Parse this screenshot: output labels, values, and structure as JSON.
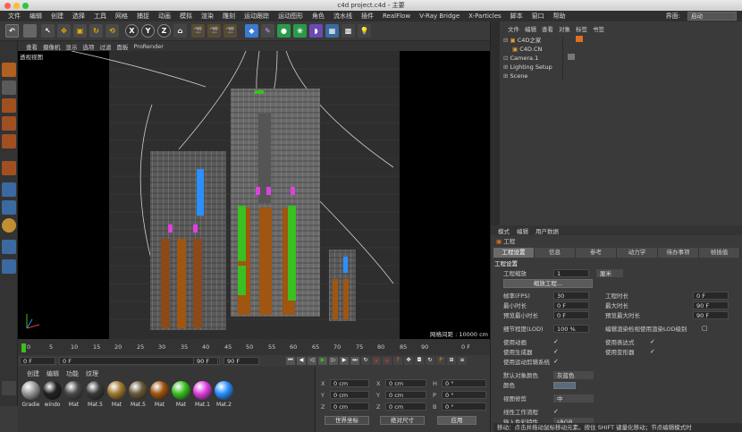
{
  "window": {
    "title": "c4d project.c4d - 主要"
  },
  "menubar": {
    "items": [
      "文件",
      "编辑",
      "创建",
      "选择",
      "工具",
      "网格",
      "捕捉",
      "动画",
      "模拟",
      "渲染",
      "雕刻",
      "运动跟踪",
      "运动图形",
      "角色",
      "流水线",
      "插件",
      "RealFlow",
      "V-Ray Bridge",
      "X-Particles",
      "脚本",
      "窗口",
      "帮助"
    ],
    "interface_label": "界面:",
    "interface_value": "启动"
  },
  "toolbar": {
    "icons": [
      "undo-icon",
      "select-icon",
      "move-icon",
      "scale-icon",
      "rotate-icon",
      "x-axis-icon",
      "y-axis-icon",
      "z-axis-icon",
      "coord-icon",
      "render-region-icon",
      "render-view-icon",
      "render-settings-icon",
      "cube-icon",
      "pen-icon",
      "subdivision-icon",
      "array-icon",
      "deformer-icon",
      "floor-icon",
      "camera-icon",
      "light-icon"
    ],
    "axis_x": "X",
    "axis_y": "Y",
    "axis_z": "Z"
  },
  "viewport": {
    "menu": [
      "查看",
      "摄像机",
      "显示",
      "选项",
      "过滤",
      "面板",
      "ProRender"
    ],
    "label": "透视视图",
    "grid_label": "网格间距 : 10000 cm"
  },
  "objects": {
    "menu": [
      "文件",
      "编辑",
      "查看",
      "对象",
      "标签",
      "书签"
    ],
    "items": [
      {
        "name": "C4D之家",
        "indent": 0
      },
      {
        "name": "C4D.CN",
        "indent": 1
      },
      {
        "name": "Camera.1",
        "indent": 0
      },
      {
        "name": "Lighting Setup",
        "indent": 0
      },
      {
        "name": "Scene",
        "indent": 0
      }
    ]
  },
  "attributes": {
    "menu": [
      "模式",
      "编辑",
      "用户数据"
    ],
    "header": "工程",
    "tabs": [
      "工程设置",
      "信息",
      "参考",
      "动力学",
      "待办事项",
      "帧插值"
    ],
    "active_tab": "工程设置",
    "section": "工程设置",
    "project_scale_label": "工程缩放",
    "project_scale_value": "1",
    "project_scale_unit": "厘米",
    "scale_project_button": "缩放工程...",
    "fps_label": "帧率(FPS)",
    "fps_value": "30",
    "min_time_label": "最小时长",
    "min_time_value": "0 F",
    "preview_min_label": "预览最小时长",
    "preview_min_value": "0 F",
    "project_time_label": "工程时长",
    "project_time_value": "0 F",
    "max_time_label": "最大时长",
    "max_time_value": "90 F",
    "preview_max_label": "预览最大时长",
    "preview_max_value": "90 F",
    "lod_label": "细节程度(LOD)",
    "lod_value": "100 %",
    "lod_render_label": "编辑渲染检视使用渲染LOD级别",
    "use_anim_label": "使用动画",
    "use_gen_label": "使用生成器",
    "use_motion_label": "使用运动剪辑系统",
    "use_expr_label": "使用表达式",
    "use_deform_label": "使用变形器",
    "default_color_label": "默认对象颜色",
    "default_color_value": "灰蓝色",
    "color_label": "颜色",
    "view_clip_label": "视图修剪",
    "view_clip_value": "中",
    "linear_label": "线性工作流程",
    "input_color_label": "输入色彩特性",
    "input_color_value": "sRGB"
  },
  "timeline": {
    "ticks": [
      "0",
      "5",
      "10",
      "15",
      "20",
      "25",
      "30",
      "35",
      "40",
      "45",
      "50",
      "55",
      "60",
      "65",
      "70",
      "75",
      "80",
      "85",
      "90"
    ],
    "frame_readout": "0 F",
    "start_field": "0 F",
    "current_field": "0 F",
    "end_field": "90 F",
    "end_field2": "90 F"
  },
  "materials": {
    "menu": [
      "创建",
      "编辑",
      "功能",
      "纹理"
    ],
    "items": [
      {
        "name": "Gradie",
        "color": "#9a9a9a"
      },
      {
        "name": "windo",
        "color": "#222222"
      },
      {
        "name": "Mat",
        "color": "#4a4a4a"
      },
      {
        "name": "Mat.5",
        "color": "#3a3a3a"
      },
      {
        "name": "Mat",
        "color": "#a07a30"
      },
      {
        "name": "Mat.5",
        "color": "#6a5a3a"
      },
      {
        "name": "Mat",
        "color": "#a05510"
      },
      {
        "name": "Mat",
        "color": "#3ac020"
      },
      {
        "name": "Mat.1",
        "color": "#e040e0"
      },
      {
        "name": "Mat.2",
        "color": "#2a90ff"
      }
    ]
  },
  "coords": {
    "position": [
      "X",
      "Y",
      "Z"
    ],
    "size": [
      "X",
      "Y",
      "Z"
    ],
    "rotation": [
      "H",
      "P",
      "B"
    ],
    "value": "0 cm",
    "angle": "0 °",
    "world_select": "世界坐标",
    "scale_select": "绝对尺寸",
    "apply_button": "应用"
  },
  "status": {
    "text": "移动：点击并拖动鼠标移动元素。按住 SHIFT 键量化移动；节点编辑模式时"
  }
}
